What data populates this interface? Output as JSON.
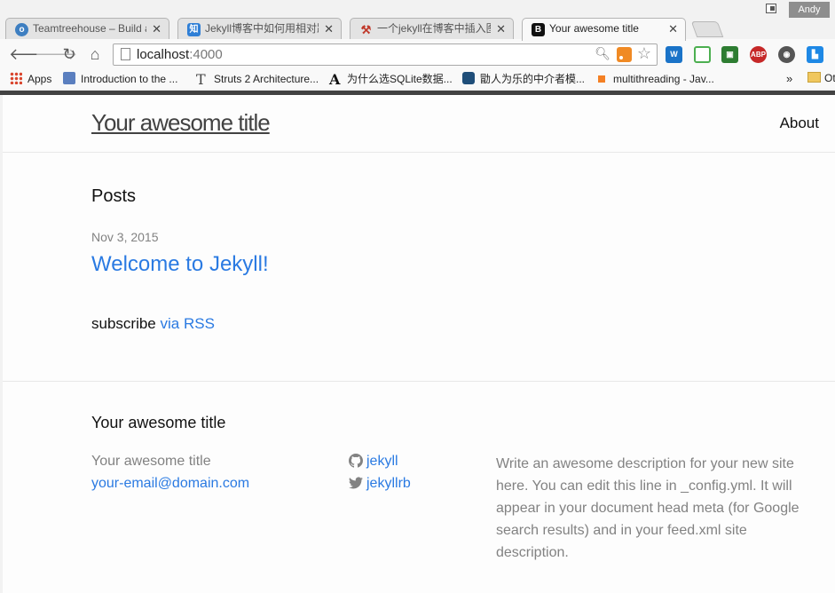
{
  "window": {
    "user_name": "Andy"
  },
  "tabs": [
    {
      "label": "Teamtreehouse – Build a",
      "favicon": "treehouse-icon",
      "color": "#3e7fc1"
    },
    {
      "label": "Jekyll博客中如何用相对路",
      "favicon": "zhihu-icon",
      "color": "#2f7fd6",
      "glyph": "知"
    },
    {
      "label": "一个jekyll在博客中插入图",
      "favicon": "tools-icon",
      "color": "#c0392b"
    },
    {
      "label": "Your awesome title",
      "favicon": "bootstrap-icon",
      "color": "#111111",
      "glyph": "B",
      "active": true
    }
  ],
  "address_bar": {
    "host": "localhost",
    "port": ":4000"
  },
  "bookmarks": [
    {
      "label": "Apps"
    },
    {
      "label": "Introduction to the ..."
    },
    {
      "label": "Struts 2 Architecture..."
    },
    {
      "label": "为什么选SQLite数据..."
    },
    {
      "label": "勖人为乐的中介者模..."
    },
    {
      "label": "multithreading - Jav..."
    }
  ],
  "bookmarks_more": "»",
  "bookmarks_folder": "Ot",
  "site": {
    "title": "Your awesome title",
    "nav": {
      "about": "About"
    },
    "posts_heading": "Posts",
    "post": {
      "date": "Nov 3, 2015",
      "title": "Welcome to Jekyll!"
    },
    "subscribe_text": "subscribe",
    "rss_label": "via RSS",
    "footer": {
      "heading": "Your awesome title",
      "name": "Your awesome title",
      "email": "your-email@domain.com",
      "github": "jekyll",
      "twitter": "jekyllrb",
      "description": "Write an awesome description for your new site here. You can edit this line in _config.yml. It will appear in your document head meta (for Google search results) and in your feed.xml site description."
    }
  },
  "colors": {
    "link": "#2a7ae2",
    "muted": "#828282",
    "text": "#111111"
  }
}
